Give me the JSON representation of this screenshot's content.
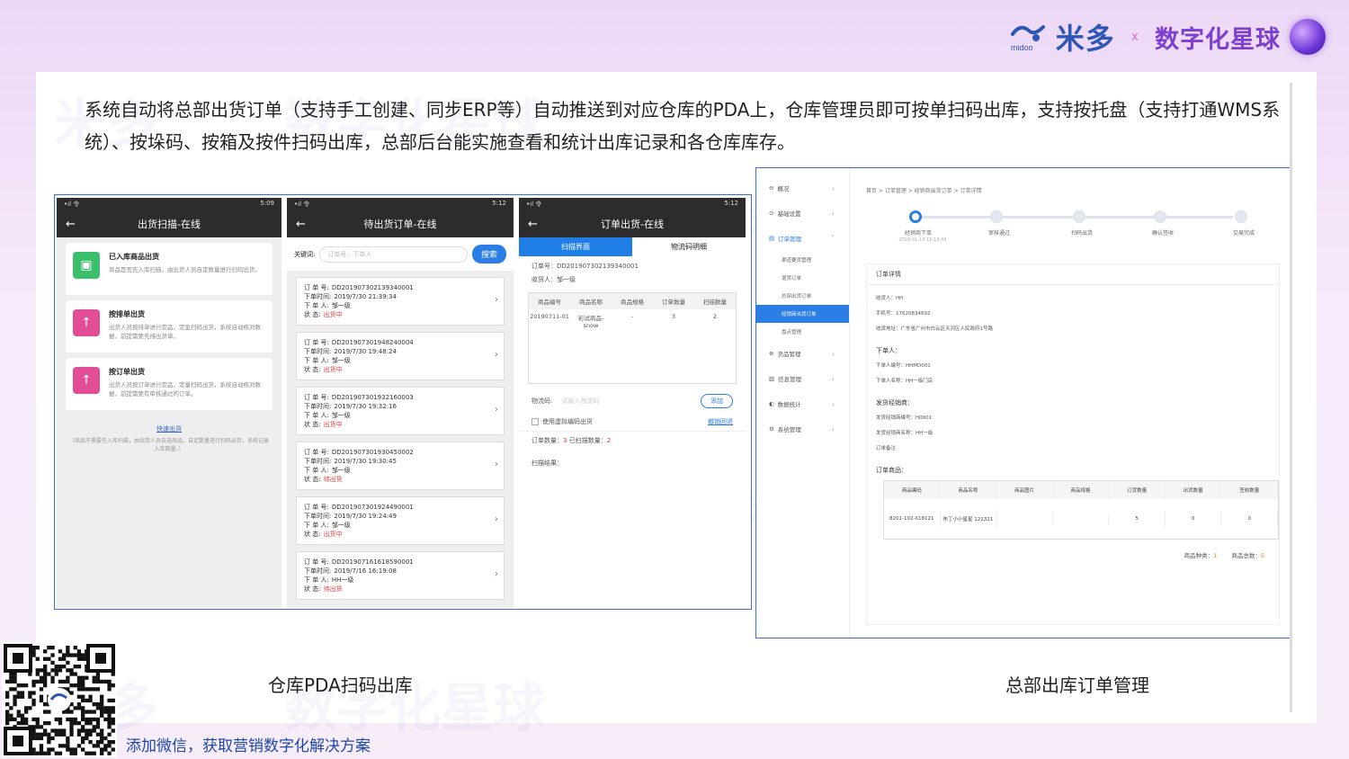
{
  "brand": {
    "name": "米多",
    "sub": "midoo",
    "x": "x",
    "partner": "数字化星球"
  },
  "intro": "系统自动将总部出货订单（支持手工创建、同步ERP等）自动推送到对应仓库的PDA上，仓库管理员即可按单扫码出库，支持按托盘（支持打通WMS系统）、按垛码、按箱及按件扫码出库，总部后台能实施查看和统计出库记录和各仓库库存。",
  "watermark": {
    "a": "米多",
    "b": "数字化星球",
    "c": "midoo"
  },
  "phone1": {
    "time": "5:09",
    "title": "出货扫描-在线",
    "options": [
      {
        "title": "已入库商品出货",
        "desc": "商品是否先入库扫描，由出货人员自定数量进行扫码出货。",
        "color": "#3cbf6c",
        "icon": "cart-icon"
      },
      {
        "title": "按排单出货",
        "desc": "出货人员按排单进行定品，定金扫码出货，系统自动核对数据，前提需要先排出货单。",
        "color": "#e34d96",
        "icon": "box-icon"
      },
      {
        "title": "按订单出货",
        "desc": "出货人员按订单进行定品，定量扫码出货，系统自动核对数据，前提需要有审核通过的订单。",
        "color": "#e34d96",
        "icon": "box-icon"
      }
    ],
    "fast": "快速出货",
    "note": "（商品不需要先入库扫描，由出货人员自选商品，自定数量进行扫码出货，系统记录入库数量。）"
  },
  "phone2": {
    "time": "5:12",
    "title": "待出货订单-在线",
    "search_label": "关键词:",
    "search_placeholder": "订单号、下单人",
    "search_btn": "搜索",
    "order_no_label": "订 单 号:",
    "order_time_label": "下单时间:",
    "order_person_label": "下 单 人:",
    "order_status_label": "状    态:",
    "orders": [
      {
        "no": "DD201907302139340001",
        "time": "2019/7/30 21:39:34",
        "person": "邹一级",
        "status": "出货中"
      },
      {
        "no": "DD201907301948240004",
        "time": "2019/7/30 19:48:24",
        "person": "邹一级",
        "status": "出货中"
      },
      {
        "no": "DD201907301932160003",
        "time": "2019/7/30 19:32:16",
        "person": "邹一级",
        "status": "出货中"
      },
      {
        "no": "DD201907301930450002",
        "time": "2019/7/30 19:30:45",
        "person": "邹一级",
        "status": "待出货"
      },
      {
        "no": "DD201907301924490001",
        "time": "2019/7/30 19:24:49",
        "person": "邹一级",
        "status": "出货中"
      },
      {
        "no": "DD201907161618590001",
        "time": "2019/7/16 16:19:08",
        "person": "HH一级",
        "status": "待出货"
      }
    ]
  },
  "phone3": {
    "time": "5:12",
    "title": "订单出货-在线",
    "tab1": "扫描界面",
    "tab2": "物流码明细",
    "order_no": "订单号：DD201907302139340001",
    "receiver": "收货人：邹一级",
    "headers": [
      "商品编号",
      "商品名称",
      "商品规格",
      "订单数量",
      "扫描数量"
    ],
    "row": [
      "20190711-01",
      "彩试商品-snow",
      "-",
      "3",
      "2"
    ],
    "logistics_label": "物流码:",
    "logistics_placeholder": "请输入物流码",
    "add_btn": "添加",
    "virtual_label": "使用虚拟编码出货",
    "reset_link": "撤销回退",
    "count_label": "订单数量：",
    "count_value": "3",
    "scanned_label": "已扫描数量：",
    "scanned_value": "2",
    "result_label": "扫描结果："
  },
  "web": {
    "nav": [
      {
        "label": "概况",
        "icon": "overview-icon"
      },
      {
        "label": "基础设置",
        "icon": "settings-icon"
      },
      {
        "label": "订单管理",
        "icon": "order-icon"
      }
    ],
    "sub_items": [
      "渠道要货管理",
      "退货订单",
      "总部出货订单",
      "经销商出货订单",
      "盘点管理"
    ],
    "nav2": [
      {
        "label": "货品管理",
        "icon": "goods-icon"
      },
      {
        "label": "信息管理",
        "icon": "info-icon"
      },
      {
        "label": "数据统计",
        "icon": "stats-icon"
      },
      {
        "label": "系统管理",
        "icon": "system-icon"
      }
    ],
    "crumbs": "首页 > 订单管理 > 经销商出货订单 > 订单详情",
    "steps": [
      "经销商下单",
      "审核通过",
      "扫码出货",
      "确认签收",
      "交易完成"
    ],
    "step_time": "2020-01-19 15:13:45",
    "detail_title": "订单详情",
    "receiver": "收货人：HH",
    "phone": "手机号：17620834692",
    "address": "收货地址：广东省广州市白云区天河区人民政府1号路",
    "orderer_title": "下单人：",
    "orderer_no": "下单人编号：HHMD001",
    "orderer_name": "下单人名称：HH一级门店",
    "dealer_title": "发货经销商：",
    "dealer_no": "发货经销商编号：H0001",
    "dealer_name": "发货经销商名称：HH一级",
    "remark": "订单备注",
    "goods_title": "订单商品：",
    "headers": [
      "商品编码",
      "商品名称",
      "商品图片",
      "商品规格",
      "订货数量",
      "出货数量",
      "签收数量"
    ],
    "row": [
      "8201-102-X18121",
      "布丁小小星星 121321",
      "",
      "",
      "5",
      "0",
      "0"
    ],
    "kinds_label": "商品种类：",
    "kinds": "1",
    "total_label": "商品总数：",
    "total": "5"
  },
  "captions": {
    "left": "仓库PDA扫码出库",
    "right": "总部出库订单管理"
  },
  "qr_caption": "添加微信，获取营销数字化解决方案",
  "colors": {
    "accent": "#2a7ee6",
    "brand": "#2e56b8",
    "purple": "#7d3fcf",
    "status_red": "#e03a3a"
  }
}
